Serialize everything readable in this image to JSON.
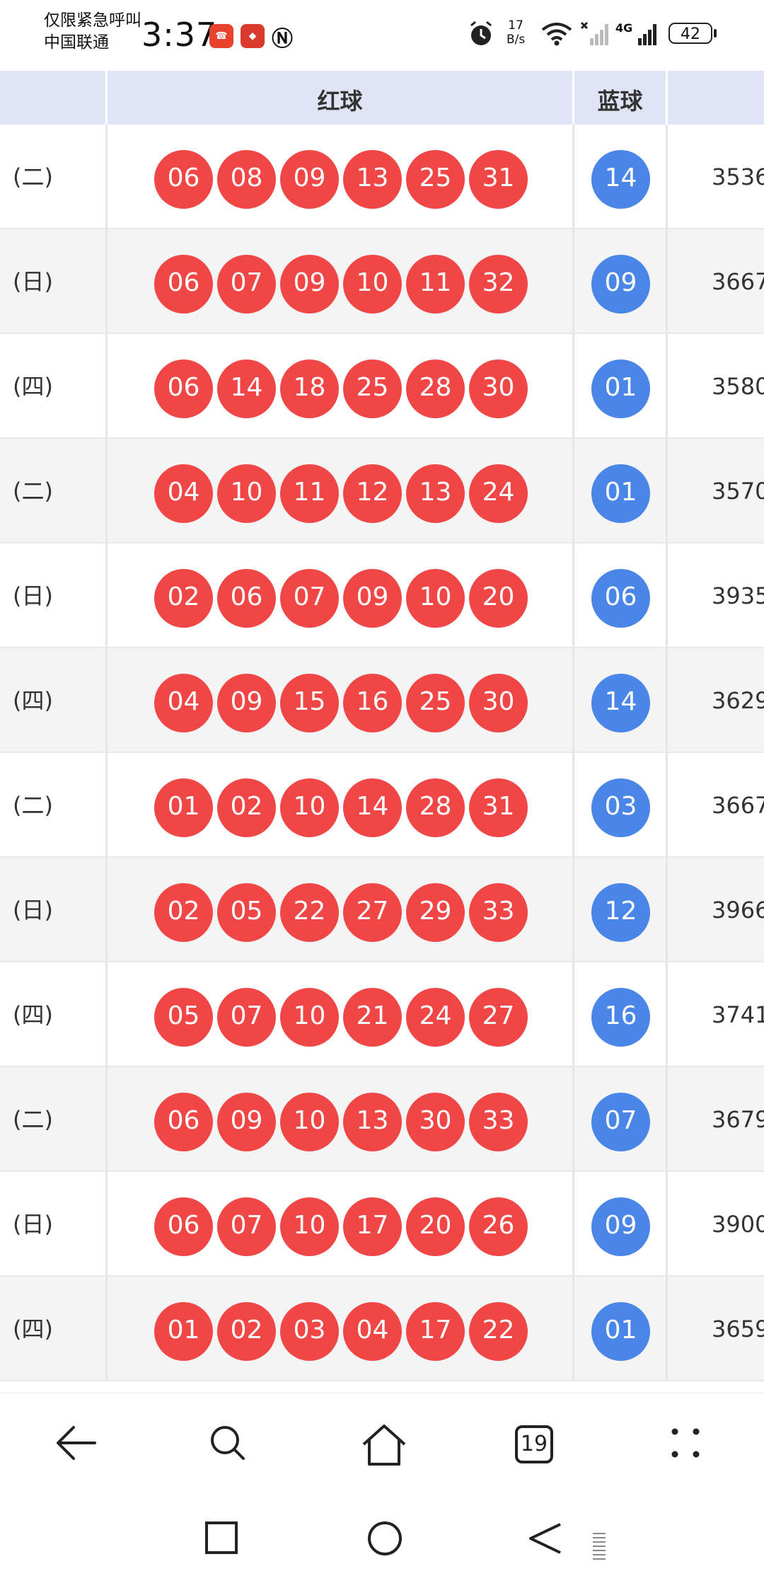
{
  "status_bar": {
    "notice_line1": "仅限紧急呼叫",
    "notice_line2": "中国联通",
    "time": "3:37",
    "net_speed_value": "17",
    "net_speed_unit": "B/s",
    "network_type": "4G",
    "battery": "42"
  },
  "table": {
    "headers": {
      "red": "红球",
      "blue": "蓝球"
    },
    "rows": [
      {
        "day": "(二)",
        "red": [
          "06",
          "08",
          "09",
          "13",
          "25",
          "31"
        ],
        "blue": "14",
        "sales": "3536"
      },
      {
        "day": "(日)",
        "red": [
          "06",
          "07",
          "09",
          "10",
          "11",
          "32"
        ],
        "blue": "09",
        "sales": "3667"
      },
      {
        "day": "(四)",
        "red": [
          "06",
          "14",
          "18",
          "25",
          "28",
          "30"
        ],
        "blue": "01",
        "sales": "3580"
      },
      {
        "day": "(二)",
        "red": [
          "04",
          "10",
          "11",
          "12",
          "13",
          "24"
        ],
        "blue": "01",
        "sales": "3570"
      },
      {
        "day": "(日)",
        "red": [
          "02",
          "06",
          "07",
          "09",
          "10",
          "20"
        ],
        "blue": "06",
        "sales": "3935"
      },
      {
        "day": "(四)",
        "red": [
          "04",
          "09",
          "15",
          "16",
          "25",
          "30"
        ],
        "blue": "14",
        "sales": "3629"
      },
      {
        "day": "(二)",
        "red": [
          "01",
          "02",
          "10",
          "14",
          "28",
          "31"
        ],
        "blue": "03",
        "sales": "3667"
      },
      {
        "day": "(日)",
        "red": [
          "02",
          "05",
          "22",
          "27",
          "29",
          "33"
        ],
        "blue": "12",
        "sales": "3966"
      },
      {
        "day": "(四)",
        "red": [
          "05",
          "07",
          "10",
          "21",
          "24",
          "27"
        ],
        "blue": "16",
        "sales": "3741"
      },
      {
        "day": "(二)",
        "red": [
          "06",
          "09",
          "10",
          "13",
          "30",
          "33"
        ],
        "blue": "07",
        "sales": "3679"
      },
      {
        "day": "(日)",
        "red": [
          "06",
          "07",
          "10",
          "17",
          "20",
          "26"
        ],
        "blue": "09",
        "sales": "3900"
      },
      {
        "day": "(四)",
        "red": [
          "01",
          "02",
          "03",
          "04",
          "17",
          "22"
        ],
        "blue": "01",
        "sales": "3659"
      }
    ]
  },
  "browser_nav": {
    "tab_count": "19",
    "icons": [
      "back-arrow-icon",
      "search-icon",
      "home-icon",
      "tabs-icon",
      "more-icon"
    ]
  },
  "colors": {
    "red_ball": "#f04646",
    "blue_ball": "#4a86e8",
    "header_bg": "#dfe5f5"
  }
}
